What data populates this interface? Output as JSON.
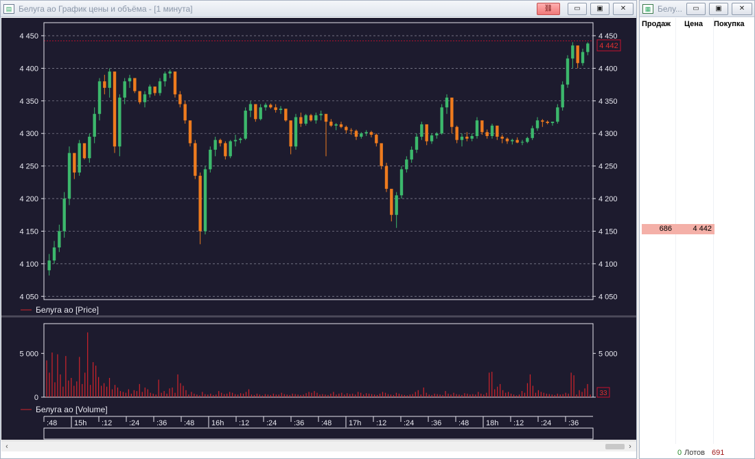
{
  "chart_window": {
    "title": "Белуга ао График цены и объёма - [1 минута]",
    "buttons": {
      "link": "⛓",
      "minimize": "▭",
      "restore": "▣",
      "close": "✕"
    }
  },
  "orderbook_window": {
    "title": "Белу...",
    "buttons": {
      "minimize": "▭",
      "restore": "▣",
      "close": "✕"
    },
    "columns": [
      "Продаж",
      "Цена",
      "Покупка"
    ],
    "row": {
      "sell": "686",
      "price": "4 442",
      "buy": ""
    },
    "footer": {
      "lots_value": "0",
      "lots_label": "Лотов",
      "total": "691"
    }
  },
  "colors": {
    "background": "#1d1b2e",
    "up": "#3cb86c",
    "down": "#ee7b1e",
    "volume": "#d3242b",
    "grid": "#8e8e9e",
    "frame": "#e6e6ee",
    "text": "#e8e8f0",
    "last_price_box": "#c8102e"
  },
  "chart_data": [
    {
      "type": "candlestick",
      "legend": "Белуга ао [Price]",
      "ylim": [
        4045,
        4470
      ],
      "y_ticks_left": [
        "4 450",
        "4 400",
        "4 350",
        "4 300",
        "4 250",
        "4 200",
        "4 150",
        "4 100",
        "4 050"
      ],
      "y_ticks_right": [
        "4 450",
        "4 400",
        "4 350",
        "4 300",
        "4 250",
        "4 200",
        "4 150",
        "4 100",
        "4 050"
      ],
      "y_tick_values": [
        4450,
        4400,
        4350,
        4300,
        4250,
        4200,
        4150,
        4100,
        4050
      ],
      "last_price": "4 442",
      "last_price_value": 4442,
      "ohlc": [
        [
          4090,
          4115,
          4082,
          4105
        ],
        [
          4105,
          4135,
          4100,
          4125
        ],
        [
          4125,
          4160,
          4118,
          4150
        ],
        [
          4150,
          4210,
          4140,
          4200
        ],
        [
          4200,
          4280,
          4190,
          4270
        ],
        [
          4270,
          4260,
          4230,
          4240
        ],
        [
          4240,
          4290,
          4235,
          4285
        ],
        [
          4285,
          4275,
          4260,
          4262
        ],
        [
          4262,
          4300,
          4255,
          4295
        ],
        [
          4295,
          4340,
          4285,
          4330
        ],
        [
          4330,
          4385,
          4320,
          4380
        ],
        [
          4380,
          4390,
          4360,
          4370
        ],
        [
          4370,
          4400,
          4355,
          4395
        ],
        [
          4395,
          4340,
          4270,
          4280
        ],
        [
          4280,
          4360,
          4265,
          4355
        ],
        [
          4355,
          4385,
          4345,
          4380
        ],
        [
          4380,
          4390,
          4370,
          4385
        ],
        [
          4385,
          4378,
          4362,
          4365
        ],
        [
          4365,
          4360,
          4345,
          4348
        ],
        [
          4348,
          4365,
          4340,
          4360
        ],
        [
          4360,
          4375,
          4355,
          4372
        ],
        [
          4372,
          4370,
          4358,
          4362
        ],
        [
          4362,
          4385,
          4358,
          4380
        ],
        [
          4380,
          4395,
          4372,
          4392
        ],
        [
          4392,
          4398,
          4385,
          4395
        ],
        [
          4395,
          4380,
          4355,
          4360
        ],
        [
          4360,
          4365,
          4340,
          4345
        ],
        [
          4345,
          4350,
          4315,
          4320
        ],
        [
          4320,
          4310,
          4280,
          4285
        ],
        [
          4285,
          4290,
          4230,
          4235
        ],
        [
          4235,
          4240,
          4130,
          4150
        ],
        [
          4150,
          4250,
          4145,
          4245
        ],
        [
          4245,
          4280,
          4240,
          4275
        ],
        [
          4275,
          4295,
          4265,
          4290
        ],
        [
          4290,
          4292,
          4280,
          4285
        ],
        [
          4285,
          4288,
          4260,
          4265
        ],
        [
          4265,
          4290,
          4262,
          4288
        ],
        [
          4288,
          4298,
          4280,
          4290
        ],
        [
          4290,
          4294,
          4285,
          4292
        ],
        [
          4292,
          4340,
          4290,
          4335
        ],
        [
          4335,
          4350,
          4325,
          4345
        ],
        [
          4345,
          4342,
          4318,
          4322
        ],
        [
          4322,
          4345,
          4320,
          4340
        ],
        [
          4340,
          4347,
          4335,
          4344
        ],
        [
          4344,
          4346,
          4338,
          4340
        ],
        [
          4340,
          4345,
          4332,
          4336
        ],
        [
          4336,
          4342,
          4330,
          4338
        ],
        [
          4338,
          4335,
          4318,
          4320
        ],
        [
          4320,
          4315,
          4268,
          4280
        ],
        [
          4280,
          4330,
          4275,
          4325
        ],
        [
          4325,
          4332,
          4310,
          4315
        ],
        [
          4315,
          4330,
          4312,
          4328
        ],
        [
          4328,
          4330,
          4318,
          4320
        ],
        [
          4320,
          4332,
          4315,
          4328
        ],
        [
          4328,
          4335,
          4320,
          4330
        ],
        [
          4330,
          4328,
          4265,
          4318
        ],
        [
          4318,
          4322,
          4310,
          4312
        ],
        [
          4312,
          4316,
          4305,
          4314
        ],
        [
          4314,
          4318,
          4308,
          4310
        ],
        [
          4310,
          4312,
          4300,
          4305
        ],
        [
          4305,
          4308,
          4298,
          4304
        ],
        [
          4304,
          4306,
          4290,
          4295
        ],
        [
          4295,
          4302,
          4292,
          4300
        ],
        [
          4300,
          4305,
          4296,
          4302
        ],
        [
          4302,
          4304,
          4294,
          4298
        ],
        [
          4298,
          4300,
          4280,
          4285
        ],
        [
          4285,
          4270,
          4245,
          4250
        ],
        [
          4250,
          4255,
          4210,
          4215
        ],
        [
          4215,
          4200,
          4165,
          4175
        ],
        [
          4175,
          4210,
          4155,
          4205
        ],
        [
          4205,
          4250,
          4200,
          4245
        ],
        [
          4245,
          4265,
          4240,
          4260
        ],
        [
          4260,
          4280,
          4255,
          4275
        ],
        [
          4275,
          4300,
          4270,
          4295
        ],
        [
          4295,
          4318,
          4290,
          4314
        ],
        [
          4314,
          4310,
          4282,
          4288
        ],
        [
          4288,
          4300,
          4284,
          4297
        ],
        [
          4297,
          4302,
          4292,
          4300
        ],
        [
          4300,
          4345,
          4298,
          4340
        ],
        [
          4340,
          4360,
          4330,
          4355
        ],
        [
          4355,
          4340,
          4300,
          4310
        ],
        [
          4310,
          4312,
          4285,
          4290
        ],
        [
          4290,
          4300,
          4280,
          4295
        ],
        [
          4295,
          4302,
          4288,
          4292
        ],
        [
          4292,
          4300,
          4288,
          4296
        ],
        [
          4296,
          4325,
          4292,
          4320
        ],
        [
          4320,
          4315,
          4298,
          4302
        ],
        [
          4302,
          4306,
          4292,
          4296
        ],
        [
          4296,
          4315,
          4292,
          4312
        ],
        [
          4312,
          4310,
          4290,
          4295
        ],
        [
          4295,
          4298,
          4285,
          4292
        ],
        [
          4292,
          4294,
          4284,
          4288
        ],
        [
          4288,
          4292,
          4283,
          4290
        ],
        [
          4290,
          4294,
          4285,
          4286
        ],
        [
          4286,
          4290,
          4282,
          4287
        ],
        [
          4287,
          4295,
          4285,
          4293
        ],
        [
          4293,
          4312,
          4290,
          4308
        ],
        [
          4308,
          4325,
          4304,
          4320
        ],
        [
          4320,
          4322,
          4310,
          4318
        ],
        [
          4318,
          4320,
          4314,
          4316
        ],
        [
          4316,
          4318,
          4312,
          4318
        ],
        [
          4318,
          4345,
          4315,
          4340
        ],
        [
          4340,
          4380,
          4335,
          4375
        ],
        [
          4375,
          4420,
          4370,
          4415
        ],
        [
          4415,
          4440,
          4400,
          4435
        ],
        [
          4435,
          4432,
          4400,
          4408
        ],
        [
          4408,
          4430,
          4404,
          4425
        ],
        [
          4425,
          4440,
          4420,
          4438
        ]
      ]
    },
    {
      "type": "bar",
      "legend": "Белуга ао [Volume]",
      "ylim": [
        0,
        8400
      ],
      "y_ticks_left": [
        "5 000",
        "0"
      ],
      "y_ticks_right": [
        "5 000",
        ""
      ],
      "y_tick_values": [
        5000,
        0
      ],
      "last_volume": "33",
      "values": [
        4200,
        2800,
        5100,
        1700,
        4900,
        2600,
        1200,
        4700,
        1900,
        2200,
        1300,
        1800,
        4600,
        1500,
        2800,
        7400,
        1400,
        4000,
        3600,
        2300,
        1300,
        1600,
        1200,
        2200,
        900,
        1400,
        1100,
        700,
        600,
        500,
        900,
        400,
        800,
        700,
        1500,
        600,
        1100,
        900,
        500,
        400,
        300,
        2000,
        500,
        700,
        400,
        1000,
        1100,
        500,
        2600,
        1600,
        1300,
        800,
        300,
        600,
        400,
        300,
        200,
        600,
        350,
        300,
        400,
        250,
        300,
        700,
        500,
        350,
        400,
        600,
        500,
        350,
        300,
        450,
        400,
        600,
        900,
        300,
        250,
        400,
        300,
        200,
        350,
        300,
        250,
        400,
        300,
        300,
        500,
        350,
        300,
        250,
        400,
        350,
        300,
        250,
        300,
        450,
        600,
        500,
        700,
        500,
        300,
        350,
        300,
        250,
        400,
        600,
        300,
        400,
        500,
        300,
        450,
        350,
        400,
        300,
        600,
        500,
        300,
        450,
        400,
        350,
        300,
        250,
        400,
        600,
        500,
        350,
        300,
        250,
        500,
        400,
        300,
        250,
        200,
        300,
        350,
        600,
        800,
        300,
        1100,
        500,
        300,
        250,
        400,
        350,
        300,
        250,
        700,
        400,
        300,
        500,
        350,
        300,
        250,
        450,
        400,
        300,
        350,
        300,
        600,
        400,
        300,
        500,
        2800,
        2900,
        900,
        1200,
        1500,
        800,
        500,
        600,
        400,
        300,
        200,
        300,
        700,
        500,
        1600,
        2600,
        1300,
        500,
        800,
        600,
        500,
        400,
        350,
        300,
        250,
        400,
        300,
        350,
        500,
        400,
        2800,
        2500,
        300,
        800,
        600,
        1000,
        1500,
        300
      ]
    }
  ],
  "time_axis": {
    "labels": [
      ":48",
      "15h",
      ":12",
      ":24",
      ":36",
      ":48",
      "16h",
      ":12",
      ":24",
      ":36",
      ":48",
      "17h",
      ":12",
      ":24",
      ":36",
      ":48",
      "18h",
      ":12",
      ":24",
      ":36"
    ],
    "hour_labels": [
      "15h",
      "16h",
      "17h",
      "18h"
    ]
  }
}
